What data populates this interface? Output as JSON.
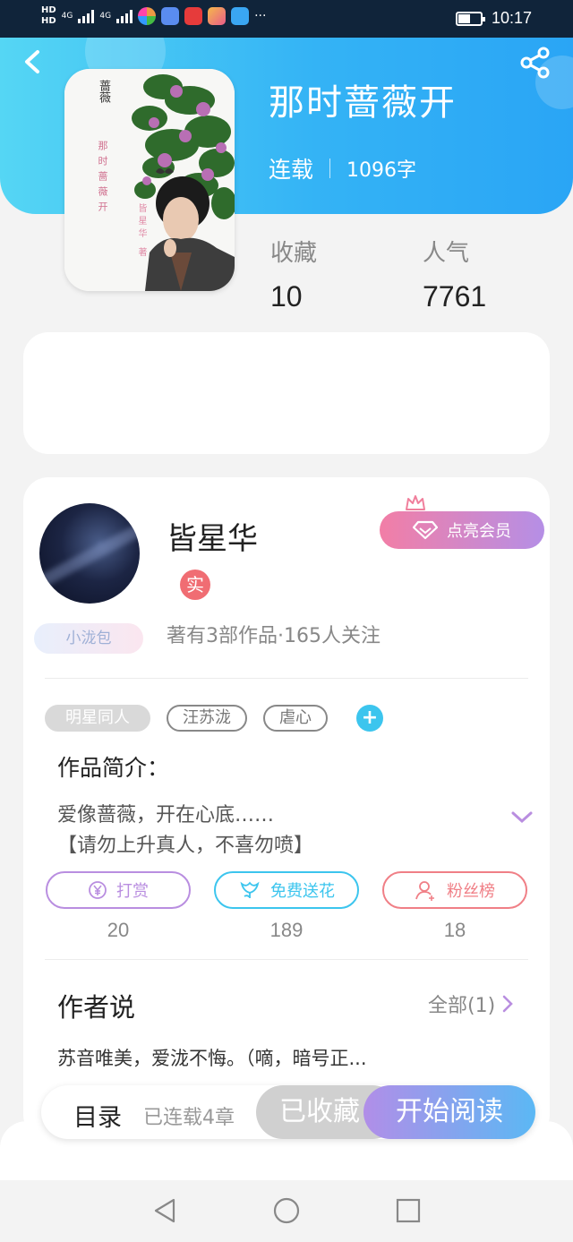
{
  "status_bar": {
    "hd_top": "HD",
    "hd_bottom": "HD",
    "net1": "4G",
    "net2": "4G",
    "dots": "···",
    "time": "10:17",
    "battery_level": 0.55
  },
  "book": {
    "title": "那时蔷薇开",
    "status": "连载",
    "word_count": "1096字",
    "cover_text": [
      "蔷薇",
      "那时蔷薇开",
      "皆星华 著"
    ],
    "stats": [
      {
        "label": "收藏",
        "value": "10"
      },
      {
        "label": "人气",
        "value": "7761"
      }
    ]
  },
  "author": {
    "name": "皆星华",
    "real_badge": "实",
    "member_button": "点亮会员",
    "works_line": "著有3部作品·165人关注",
    "pet_badge": "小泷包"
  },
  "tags": [
    "明星同人",
    "汪苏泷",
    "虐心"
  ],
  "tag_add": "+",
  "intro": {
    "heading": "作品简介：",
    "lines": [
      "爱像蔷薇，开在心底……",
      "【请勿上升真人，不喜勿喷】"
    ]
  },
  "actions": [
    {
      "label": "打赏",
      "count": "20",
      "color": "#b98ee0",
      "icon": "yen-icon"
    },
    {
      "label": "免费送花",
      "count": "189",
      "color": "#3cc5ee",
      "icon": "flower-icon"
    },
    {
      "label": "粉丝榜",
      "count": "18",
      "color": "#f07f86",
      "icon": "user-icon"
    }
  ],
  "author_says": {
    "heading": "作者说",
    "all_label": "全部(1)",
    "text": "苏音唯美，爱泷不悔。（嘀，暗号正..."
  },
  "bottom_bar": {
    "toc": "目录",
    "toc_sub": "已连载4章",
    "collected": "已收藏",
    "start_read": "开始阅读"
  },
  "colors": {
    "header_gradient_start": "#55d6f4",
    "header_gradient_end": "#2aa5f5",
    "member_gradient_start": "#f27ea6",
    "member_gradient_end": "#b58fe6",
    "real_badge": "#f06d73",
    "accent_blue": "#3cc5ee"
  }
}
